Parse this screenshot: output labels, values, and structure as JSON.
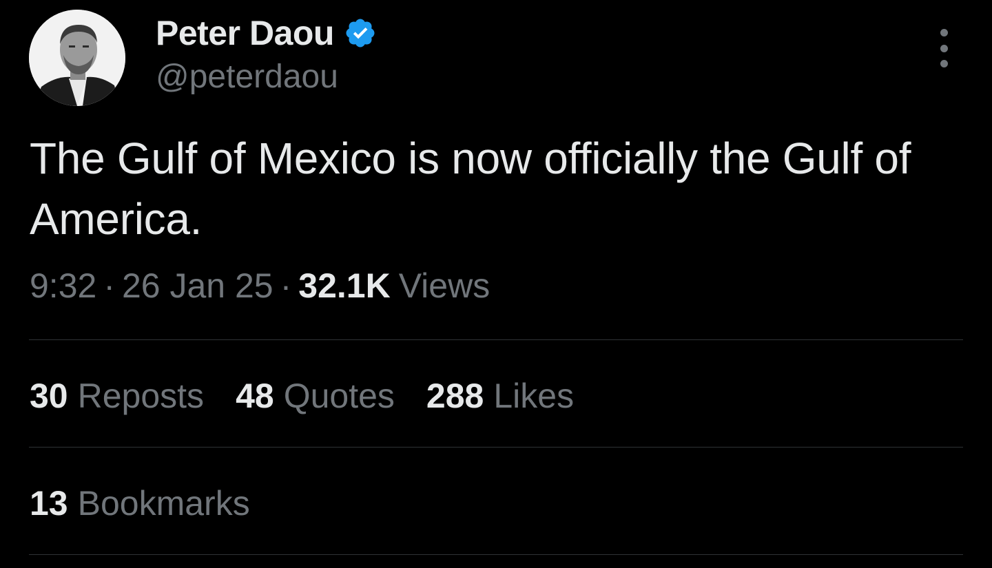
{
  "author": {
    "display_name": "Peter Daou",
    "handle": "@peterdaou",
    "verified": true,
    "verified_color": "#1d9bf0"
  },
  "tweet": {
    "text": "The Gulf of Mexico is now officially the Gulf of America.",
    "time": "9:32",
    "date": "26 Jan 25",
    "separator": "·",
    "views_count": "32.1K",
    "views_label": "Views"
  },
  "stats": {
    "reposts": {
      "count": "30",
      "label": "Reposts"
    },
    "quotes": {
      "count": "48",
      "label": "Quotes"
    },
    "likes": {
      "count": "288",
      "label": "Likes"
    },
    "bookmarks": {
      "count": "13",
      "label": "Bookmarks"
    }
  },
  "icons": {
    "verified": "verified-badge-icon",
    "more": "more-options-icon"
  },
  "colors": {
    "background": "#000000",
    "primary_text": "#e7e9ea",
    "secondary_text": "#71767b",
    "divider": "#2f3336",
    "accent": "#1d9bf0"
  }
}
